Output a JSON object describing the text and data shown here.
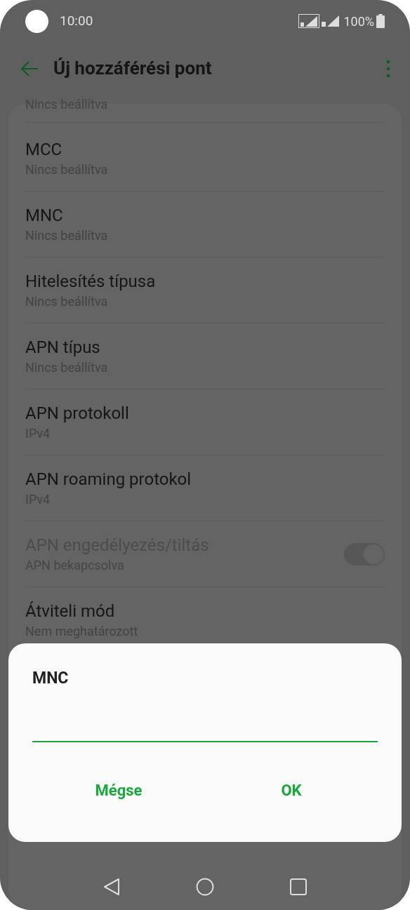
{
  "status_bar": {
    "time": "10:00",
    "battery": "100%"
  },
  "header": {
    "title": "Új hozzáférési pont"
  },
  "settings": {
    "cut_subtitle": "Nincs beállítva",
    "items": [
      {
        "kind": "text",
        "title": "MCC",
        "subtitle": "Nincs beállítva",
        "disabled": false
      },
      {
        "kind": "text",
        "title": "MNC",
        "subtitle": "Nincs beállítva",
        "disabled": false
      },
      {
        "kind": "text",
        "title": "Hitelesítés típusa",
        "subtitle": "Nincs beállítva",
        "disabled": false
      },
      {
        "kind": "text",
        "title": "APN típus",
        "subtitle": "Nincs beállítva",
        "disabled": false
      },
      {
        "kind": "text",
        "title": "APN protokoll",
        "subtitle": "IPv4",
        "disabled": false
      },
      {
        "kind": "text",
        "title": "APN roaming protokol",
        "subtitle": "IPv4",
        "disabled": false
      },
      {
        "kind": "toggle",
        "title": "APN engedélyezés/tiltás",
        "subtitle": "APN bekapcsolva",
        "disabled": true,
        "on": true
      },
      {
        "kind": "text",
        "title": "Átviteli mód",
        "subtitle": "Nem meghatározott",
        "disabled": false
      }
    ]
  },
  "dialog": {
    "title": "MNC",
    "buttons": [
      "Mégse",
      "OK"
    ]
  }
}
